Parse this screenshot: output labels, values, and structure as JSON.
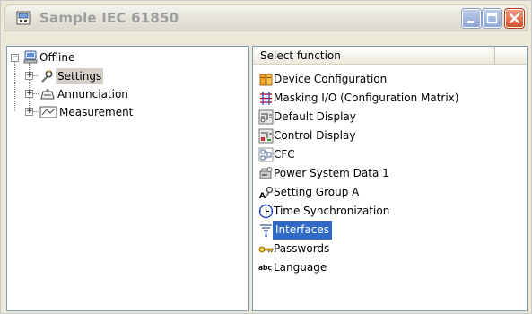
{
  "window": {
    "title": "Sample IEC 61850"
  },
  "tree": {
    "root": {
      "label": "Offline",
      "icon": "computer-icon"
    },
    "items": [
      {
        "label": "Settings",
        "icon": "settings-icon",
        "selected": true
      },
      {
        "label": "Annunciation",
        "icon": "annunciation-icon",
        "selected": false
      },
      {
        "label": "Measurement",
        "icon": "measurement-icon",
        "selected": false
      }
    ]
  },
  "list": {
    "column_header": "Select function",
    "items": [
      {
        "label": "Device Configuration",
        "icon": "device-configuration-icon"
      },
      {
        "label": "Masking I/O (Configuration Matrix)",
        "icon": "matrix-icon"
      },
      {
        "label": "Default Display",
        "icon": "default-display-icon"
      },
      {
        "label": "Control Display",
        "icon": "control-display-icon"
      },
      {
        "label": "CFC",
        "icon": "cfc-icon"
      },
      {
        "label": "Power System Data 1",
        "icon": "power-system-icon"
      },
      {
        "label": "Setting Group A",
        "icon": "setting-group-icon"
      },
      {
        "label": "Time Synchronization",
        "icon": "clock-icon"
      },
      {
        "label": "Interfaces",
        "icon": "interfaces-icon",
        "selected": true
      },
      {
        "label": "Passwords",
        "icon": "key-icon"
      },
      {
        "label": "Language",
        "icon": "language-icon",
        "glyph": "abc"
      }
    ]
  },
  "colors": {
    "selection": "#316ac5",
    "title_inactive": "#9e9e9e"
  }
}
